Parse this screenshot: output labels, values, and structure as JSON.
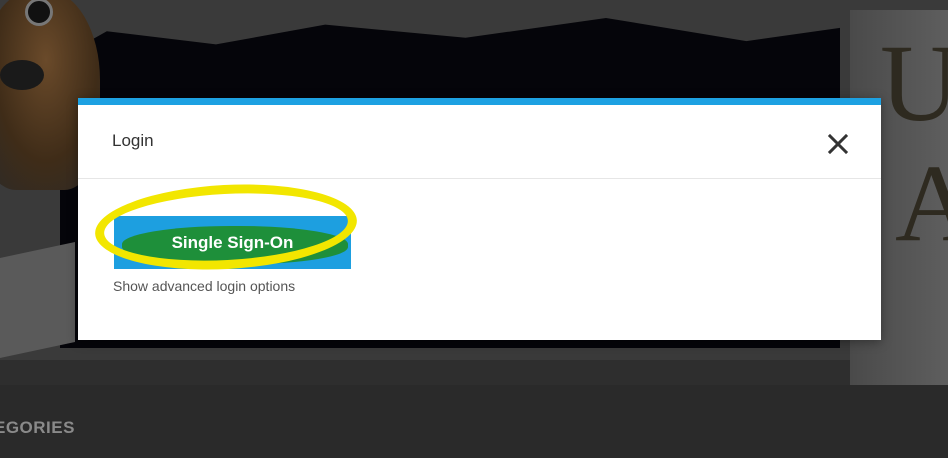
{
  "background": {
    "categories_label": "EGORIES"
  },
  "modal": {
    "title": "Login",
    "close_icon": "close-icon",
    "accent_color": "#1da1e2",
    "sso_button_label": "Single Sign-On",
    "advanced_link": "Show advanced login options"
  },
  "annotation": {
    "highlight_color": "#f2e600",
    "marker_color": "#1e8f3a"
  }
}
